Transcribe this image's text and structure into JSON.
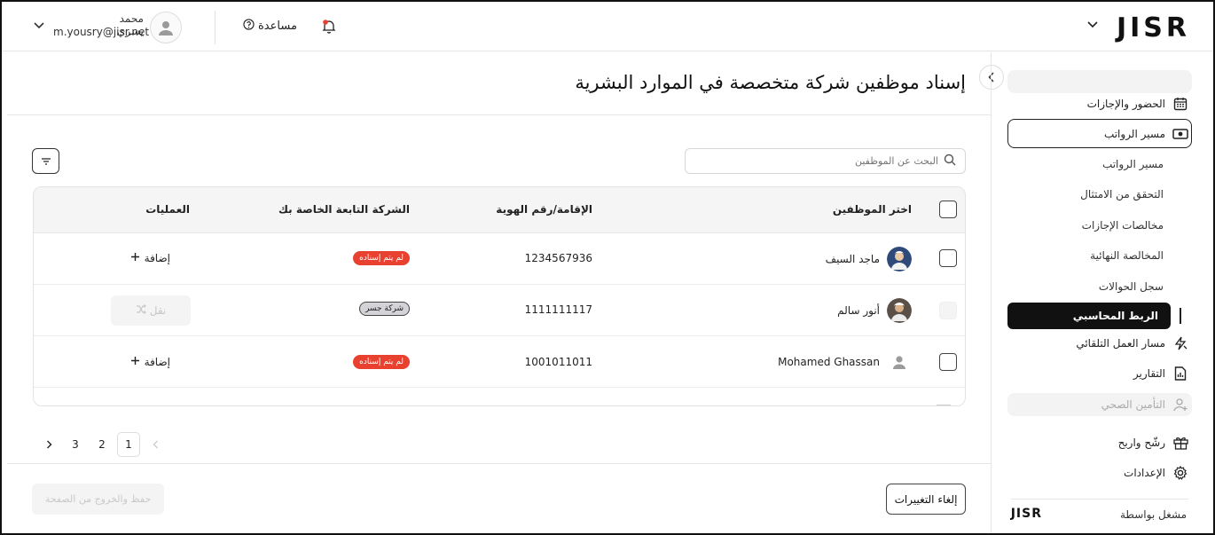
{
  "header": {
    "logo": "JISR",
    "user_name": "محمد يسري",
    "user_email": "m.yousry@jisr.net",
    "help_label": "مساعدة",
    "accent_red": "#e8412f"
  },
  "sidebar": {
    "items": [
      {
        "label": "الحضور والإجازات",
        "icon": "calendar-icon"
      },
      {
        "label": "مسير الرواتب",
        "icon": "money-icon"
      },
      {
        "label": "مسار العمل التلقائي",
        "icon": "automation-icon"
      },
      {
        "label": "التقارير",
        "icon": "report-icon"
      },
      {
        "label": "التأمين الصحي",
        "icon": "health-icon"
      },
      {
        "label": "رشّح واربح",
        "icon": "gift-icon"
      },
      {
        "label": "الإعدادات",
        "icon": "gear-icon"
      }
    ],
    "sub_items": [
      "مسير الرواتب",
      "التحقق من الامتثال",
      "مخالصات الإجازات",
      "المخالصة النهائية",
      "سجل الحوالات",
      "الربط المحاسبي"
    ],
    "powered_by": "مشغل بواسطة",
    "powered_logo": "JISR"
  },
  "main": {
    "title": "إسناد موظفين شركة متخصصة في الموارد البشرية",
    "search_placeholder": "البحث عن الموظفين",
    "table": {
      "headers": {
        "employee": "اختر الموظفين",
        "id": "الإقامة/رقم الهوية",
        "company": "الشركة التابعة الخاصة بك",
        "actions": "العمليات"
      },
      "rows": [
        {
          "name": "ماجد السيف",
          "id": "1234567936",
          "status": "لم يتم إسناده",
          "action": "إضافة"
        },
        {
          "name": "أنور سالم",
          "id": "1111111117",
          "status": "شركة جسر",
          "action": "نقل"
        },
        {
          "name": "Mohamed Ghassan",
          "id": "1001011011",
          "status": "لم يتم إسناده",
          "action": "إضافة"
        }
      ]
    },
    "pagination": {
      "pages": [
        "1",
        "2",
        "3"
      ],
      "current": "1"
    },
    "buttons": {
      "cancel": "إلغاء التغييرات",
      "save": "حفظ والخروج من الصفحة"
    }
  }
}
